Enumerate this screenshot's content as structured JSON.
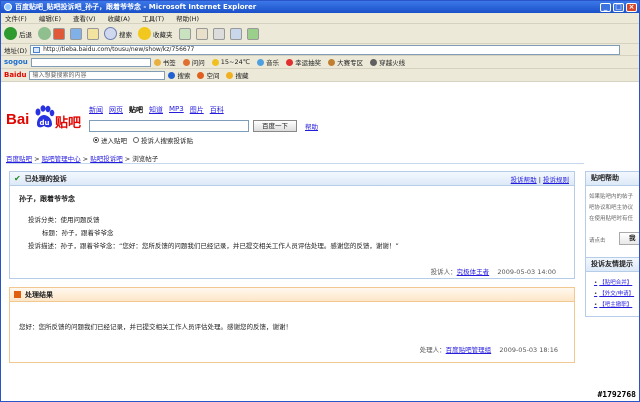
{
  "window": {
    "title": "百度贴吧_贴吧投诉吧_孙子，跟着爷爷念 - Microsoft Internet Explorer",
    "minimize": "_",
    "maximize": "□",
    "close": "×"
  },
  "menu": [
    "文件(F)",
    "编辑(E)",
    "查看(V)",
    "收藏(A)",
    "工具(T)",
    "帮助(H)"
  ],
  "toolbar": {
    "back": "后退",
    "search": "搜索",
    "favorites": "收藏夹"
  },
  "address": {
    "label": "地址(D)",
    "url": "http://tieba.baidu.com/tousu/new/show/kz/756677"
  },
  "sogou_bar": {
    "brand": "sogou",
    "items": [
      "书签",
      "问问",
      "15~24℃",
      "音乐",
      "幸运抽奖",
      "大赛专区",
      "穿越火线"
    ]
  },
  "baidu_bar": {
    "brand": "Baidu",
    "input_placeholder": "输入想要搜索的内容",
    "search": "搜索",
    "items": [
      "空间",
      "搜藏"
    ]
  },
  "header": {
    "logo_left": "Bai",
    "logo_right": "贴吧",
    "nav": [
      "新闻",
      "网页",
      "贴吧",
      "知道",
      "MP3",
      "图片",
      "百科"
    ],
    "nav_current": "贴吧",
    "search_button": "百度一下",
    "help": "帮助",
    "radio_1": "进入贴吧",
    "radio_2": "投诉人搜索投诉贴"
  },
  "breadcrumb": {
    "items": [
      "百度贴吧",
      "贴吧管理中心",
      "贴吧投诉吧"
    ],
    "separator": " > ",
    "current": "浏览帖子"
  },
  "complaint": {
    "section_title": "已处理的投诉",
    "link_help": "投诉帮助",
    "link_rules": "投诉规则",
    "title": "孙子，跟着爷爷念",
    "type_label": "投诉分类：",
    "type_value": "使用问题反馈",
    "subject_label": "标题：",
    "subject_value": "孙子，跟着爷爷念",
    "desc_label": "投诉描述：",
    "desc_value": "孙子，跟着爷爷念：“您好：您所反馈的问题我们已经记录，并已提交相关工作人员评估处理。感谢您的反馈，谢谢！”",
    "author_label": "投诉人：",
    "author": "究极体王者",
    "time": "2009-05-03 14:00"
  },
  "result": {
    "section_title": "处理结果",
    "body": "您好：您所反馈的问题我们已经记录，并已提交相关工作人员评估处理。感谢您的反馈，谢谢！",
    "handler_label": "处理人：",
    "handler": "百度贴吧管理组",
    "time": "2009-05-03 18:16"
  },
  "sidebar": {
    "box1_title": "贴吧帮助",
    "box1_lines": [
      "如果贴吧内的帖子",
      "吧协议和吧主协议",
      "在使用贴吧时有任",
      "请点击"
    ],
    "box1_button": "我",
    "box2_title": "投诉友情提示",
    "box2_items": [
      "【贴吧合并】",
      "【外交/申请】",
      "【吧主撤职】"
    ]
  },
  "watermark": "#1792768"
}
